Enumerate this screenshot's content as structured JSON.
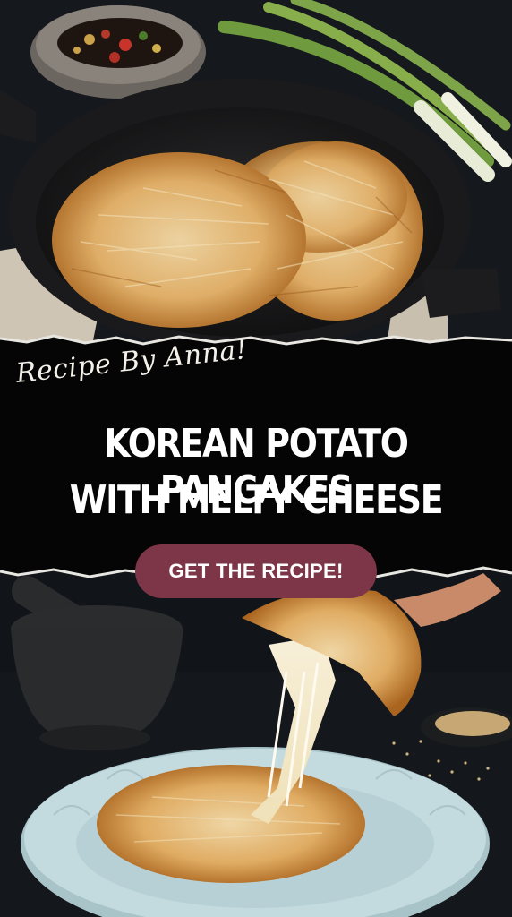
{
  "byline": "Recipe By Anna!",
  "title_lines": [
    "KOREAN POTATO PANCAKES",
    "WITH MELTY CHEESE"
  ],
  "cta_label": "GET THE RECIPE!",
  "colors": {
    "background": "#111418",
    "banner": "#050505",
    "cta": "#7d3548",
    "text": "#ffffff",
    "pancake": "#d9a25a",
    "plate": "#b9d3d8"
  },
  "images": {
    "top": "potato pancakes in cast iron skillet with scallions and dipping sauce",
    "bottom": "pancake with stretchy cheese on light blue plate, stone mortar and sesame seeds"
  }
}
